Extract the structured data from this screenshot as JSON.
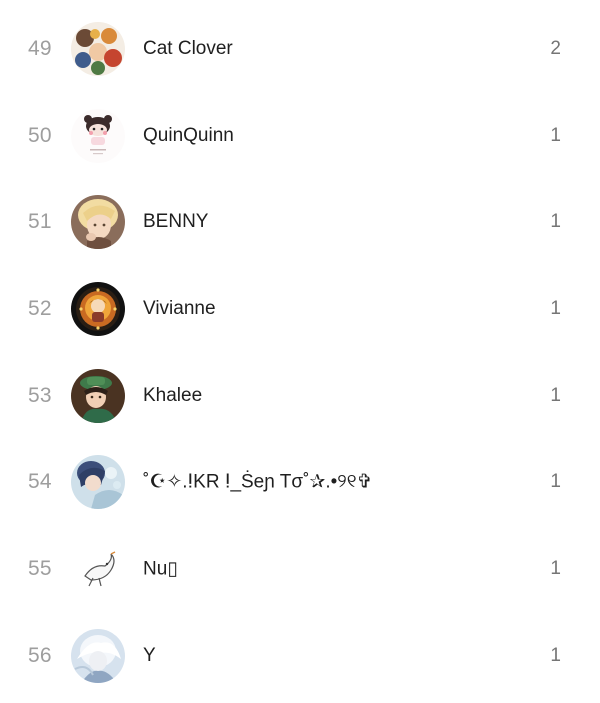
{
  "leaderboard": {
    "rows": [
      {
        "rank": "49",
        "name": "Cat Clover",
        "count": "2",
        "avatar_icon": "anime-group-avatar-icon"
      },
      {
        "rank": "50",
        "name": "QuinQuinn",
        "count": "1",
        "avatar_icon": "chibi-bear-avatar-icon"
      },
      {
        "rank": "51",
        "name": "BENNY",
        "count": "1",
        "avatar_icon": "blonde-portrait-avatar-icon"
      },
      {
        "rank": "52",
        "name": "Vivianne",
        "count": "1",
        "avatar_icon": "lantern-girl-avatar-icon"
      },
      {
        "rank": "53",
        "name": "Khalee",
        "count": "1",
        "avatar_icon": "green-hat-avatar-icon"
      },
      {
        "rank": "54",
        "name": "˚☪✧.ⵑKR ⵑ_Ṡeɲ Tσ˚✰.•୨୧✞",
        "count": "1",
        "avatar_icon": "blue-hair-avatar-icon"
      },
      {
        "rank": "55",
        "name": "Nu▯",
        "count": "1",
        "avatar_icon": "sketch-bird-avatar-icon"
      },
      {
        "rank": "56",
        "name": "Y",
        "count": "1",
        "avatar_icon": "white-hair-avatar-icon"
      }
    ]
  }
}
